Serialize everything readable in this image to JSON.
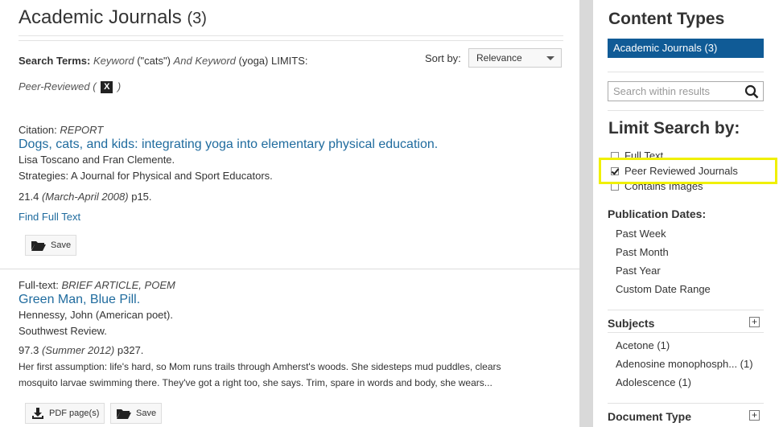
{
  "results_header": {
    "title": "Academic Journals",
    "count": "(3)"
  },
  "search": {
    "terms_label": "Search Terms:",
    "kw1_label": "Keyword",
    "kw1_value": "(\"cats\")",
    "and_label": "And",
    "kw2_label": "Keyword",
    "kw2_value": "(yoga)",
    "limits_label": "LIMITS:",
    "limit_name": "Peer-Reviewed",
    "limit_open": "(",
    "limit_x": "X",
    "limit_close": ")"
  },
  "sort": {
    "label": "Sort by:",
    "value": "Relevance"
  },
  "results": [
    {
      "type_label": "Citation:",
      "type_value": "REPORT",
      "title": "Dogs, cats, and kids: integrating yoga into elementary physical education.",
      "authors": "Lisa Toscano and Fran Clemente.",
      "source": "Strategies: A Journal for Physical and Sport Educators.",
      "volume": "21.4",
      "date": "(March-April 2008)",
      "pages": "p15.",
      "link": "Find Full Text",
      "save_label": "Save"
    },
    {
      "type_label": "Full-text:",
      "type_value": "BRIEF ARTICLE, POEM",
      "title": "Green Man, Blue Pill.",
      "authors": "Hennessy, John (American poet).",
      "source": "Southwest Review.",
      "volume": "97.3",
      "date": "(Summer 2012)",
      "pages": "p327.",
      "snippet1": "Her first assumption: life's hard, so Mom runs trails through Amherst's woods. She sidesteps mud puddles, clears",
      "snippet2": "mosquito larvae swimming there. They've got a right too, she says. Trim, spare in words and body, she wears...",
      "pdf_label": "PDF page(s)",
      "save_label": "Save"
    }
  ],
  "sidebar": {
    "content_types_title": "Content Types",
    "content_type_item": "Academic Journals  (3)",
    "search_placeholder": "Search within results",
    "limit_title": "Limit Search by:",
    "limits": [
      {
        "label": "Full Text",
        "checked": false
      },
      {
        "label": "Peer Reviewed Journals",
        "checked": true
      },
      {
        "label": "Contains Images",
        "checked": false
      }
    ],
    "pub_dates_title": "Publication Dates:",
    "pub_dates": [
      "Past Week",
      "Past Month",
      "Past Year",
      "Custom Date Range"
    ],
    "subjects_title": "Subjects",
    "subjects": [
      "Acetone (1)",
      "Adenosine monophosph...  (1)",
      "Adolescence (1)"
    ],
    "doc_type_title": "Document Type",
    "plus_glyph": "+"
  },
  "colors": {
    "accent": "#105b96",
    "link": "#1f6b9e",
    "highlight": "#f0f000"
  }
}
